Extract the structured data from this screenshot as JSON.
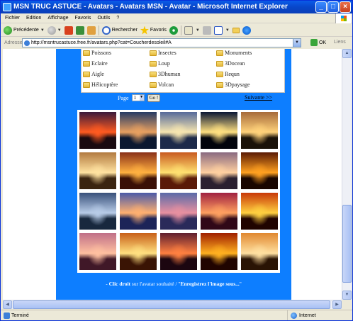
{
  "window": {
    "title": "MSN TRUC ASTUCE - Avatars - Avatars MSN - Avatar - Microsoft Internet Explorer",
    "min": "_",
    "max": "□",
    "close": "×"
  },
  "menu": [
    "Fichier",
    "Edition",
    "Affichage",
    "Favoris",
    "Outils",
    "?"
  ],
  "toolbar": {
    "back": "Précédente",
    "search": "Rechercher",
    "favorites": "Favoris"
  },
  "address": {
    "label": "Adresse",
    "url": "http://msntrucastuce.free.fr/avatars.php?cat=Coucherdesoleil#A",
    "go": "OK",
    "links": "Liens"
  },
  "categories": [
    [
      "Poissons",
      "Insectes",
      "Monuments"
    ],
    [
      "Eclaire",
      "Loup",
      "3Docean"
    ],
    [
      "Aigle",
      "3Dhuman",
      "Requn"
    ],
    [
      "Hélicoptère",
      "Volcan",
      "3Dpaysage"
    ]
  ],
  "pager": {
    "label": "Page",
    "selected": "1",
    "go": "Go !",
    "next": "Suivante >>"
  },
  "thumbnails": [
    {
      "sky": "#3a1a3a",
      "glow": "#ff5a20",
      "ground": "#1a0a10"
    },
    {
      "sky": "#253a64",
      "glow": "#e8a060",
      "ground": "#0c1830"
    },
    {
      "sky": "#55699a",
      "glow": "#f7e6b0",
      "ground": "#1d2a4a"
    },
    {
      "sky": "#0a1634",
      "glow": "#ffe080",
      "ground": "#02040c"
    },
    {
      "sky": "#a66a3a",
      "glow": "#ffd27a",
      "ground": "#1a1208"
    },
    {
      "sky": "#b27a40",
      "glow": "#ffe2a0",
      "ground": "#3a2410"
    },
    {
      "sky": "#8a3018",
      "glow": "#ffb040",
      "ground": "#3a1006"
    },
    {
      "sky": "#c85a20",
      "glow": "#ffe070",
      "ground": "#5a1a08"
    },
    {
      "sky": "#8a6a80",
      "glow": "#ffd0a0",
      "ground": "#2a2030"
    },
    {
      "sky": "#5a1a04",
      "glow": "#ffa020",
      "ground": "#1a0600"
    },
    {
      "sky": "#38507a",
      "glow": "#b8cce8",
      "ground": "#18283e"
    },
    {
      "sky": "#4a5aa8",
      "glow": "#ffb070",
      "ground": "#1c2458"
    },
    {
      "sky": "#5a6aa8",
      "glow": "#e890a0",
      "ground": "#2a2a5a"
    },
    {
      "sky": "#a02040",
      "glow": "#ffa060",
      "ground": "#300818"
    },
    {
      "sky": "#c83808",
      "glow": "#ffd040",
      "ground": "#200400"
    },
    {
      "sky": "#c07088",
      "glow": "#ffc0a0",
      "ground": "#401828"
    },
    {
      "sky": "#c86018",
      "glow": "#ffe080",
      "ground": "#3a1404"
    },
    {
      "sky": "#602030",
      "glow": "#ff8040",
      "ground": "#1c0610"
    },
    {
      "sky": "#a02000",
      "glow": "#ffb020",
      "ground": "#200400"
    },
    {
      "sky": "#e08830",
      "glow": "#ffe0a0",
      "ground": "#2a1404"
    }
  ],
  "caption": {
    "prefix": "- ",
    "action": "Clic droit",
    "middle": " sur l'avatar souhaité / \"",
    "command": "Enregistrez l'image sous...",
    "suffix": "\""
  },
  "status": {
    "text": "Terminé",
    "zone": "Internet"
  }
}
